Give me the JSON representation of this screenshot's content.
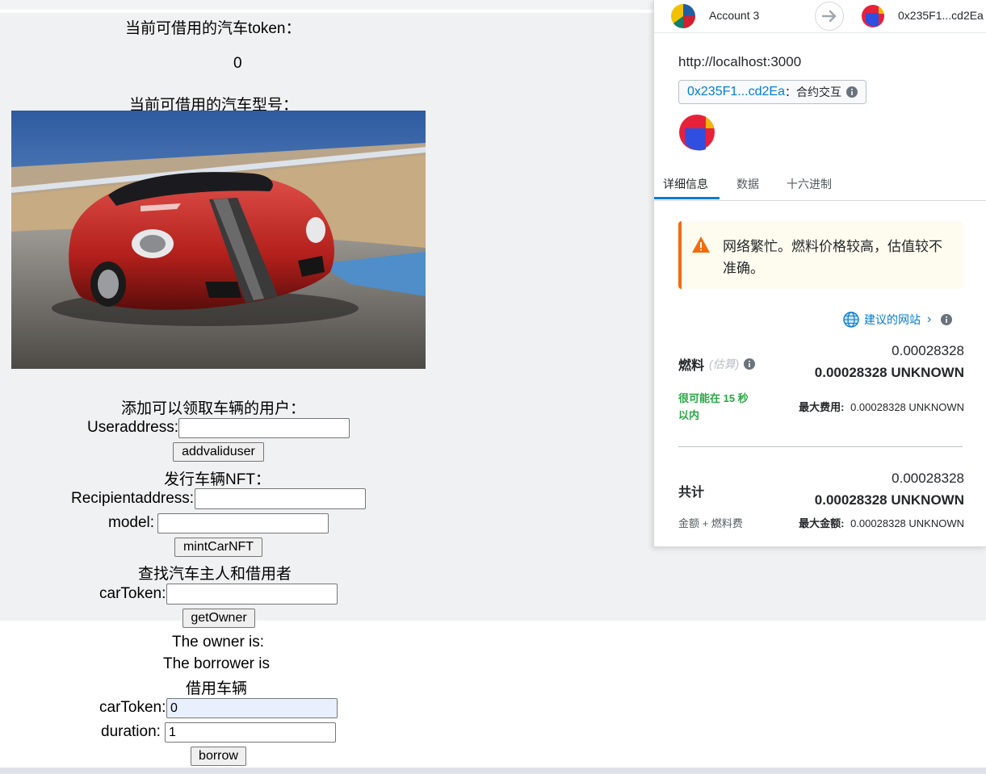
{
  "dapp": {
    "available_token_label": "当前可借用的汽车token：",
    "available_token_value": "0",
    "available_model_label": "当前可借用的汽车型号：",
    "add_user_heading": "添加可以领取车辆的用户：",
    "useraddress_label": "Useraddress:",
    "useraddress_value": "",
    "addvaliduser_button": "addvaliduser",
    "mint_heading": "发行车辆NFT：",
    "recipient_label": "Recipientaddress:",
    "recipient_value": "",
    "model_label": "model:",
    "model_value": "",
    "mint_button": "mintCarNFT",
    "find_heading": "查找汽车主人和借用者",
    "cartoken_label": "carToken:",
    "cartoken_value": "",
    "getowner_button": "getOwner",
    "owner_text": "The owner is:",
    "borrower_text": "The borrower is",
    "borrow_heading": "借用车辆",
    "borrow_cartoken_label": "carToken:",
    "borrow_cartoken_value": "0",
    "duration_label": "duration:",
    "duration_value": "1",
    "borrow_button": "borrow"
  },
  "metamask": {
    "account_name": "Account 3",
    "to_address": "0x235F1...cd2Ea",
    "origin": "http://localhost:3000",
    "contract_address": "0x235F1...cd2Ea",
    "contract_action": "：合约交互",
    "tabs": [
      "详细信息",
      "数据",
      "十六进制"
    ],
    "active_tab": 0,
    "warning_text_line1": "网络繁忙。燃料价格较高，估值较不",
    "warning_text_line2": "准确。",
    "suggested_site": "建议的网站",
    "gas_label": "燃料",
    "gas_estimate_label": "(估算)",
    "gas_value_small": "0.00028328",
    "gas_value_bold": "0.00028328 UNKNOWN",
    "likely_line1": "很可能在 15 秒",
    "likely_line2": "以内",
    "max_fee_label": "最大费用:",
    "max_fee_value": "0.00028328 UNKNOWN",
    "total_label": "共计",
    "total_value_small": "0.00028328",
    "total_value_bold": "0.00028328 UNKNOWN",
    "total_sub_label": "金额 + 燃料费",
    "max_amount_label": "最大金额:",
    "max_amount_value": "0.00028328 UNKNOWN",
    "colors": {
      "accent_blue": "#037dd6",
      "warning_orange": "#f66a0a",
      "success_green": "#28a745"
    }
  }
}
